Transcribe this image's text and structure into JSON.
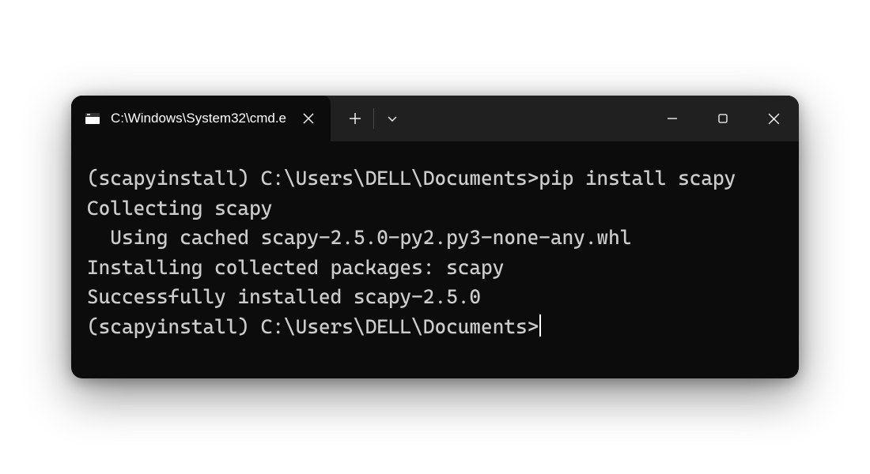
{
  "titlebar": {
    "tab_title": "C:\\Windows\\System32\\cmd.e"
  },
  "terminal": {
    "lines": [
      "(scapyinstall) C:\\Users\\DELL\\Documents>pip install scapy",
      "Collecting scapy",
      "  Using cached scapy-2.5.0-py2.py3-none-any.whl",
      "Installing collected packages: scapy",
      "Successfully installed scapy-2.5.0",
      ""
    ],
    "prompt": "(scapyinstall) C:\\Users\\DELL\\Documents>"
  }
}
